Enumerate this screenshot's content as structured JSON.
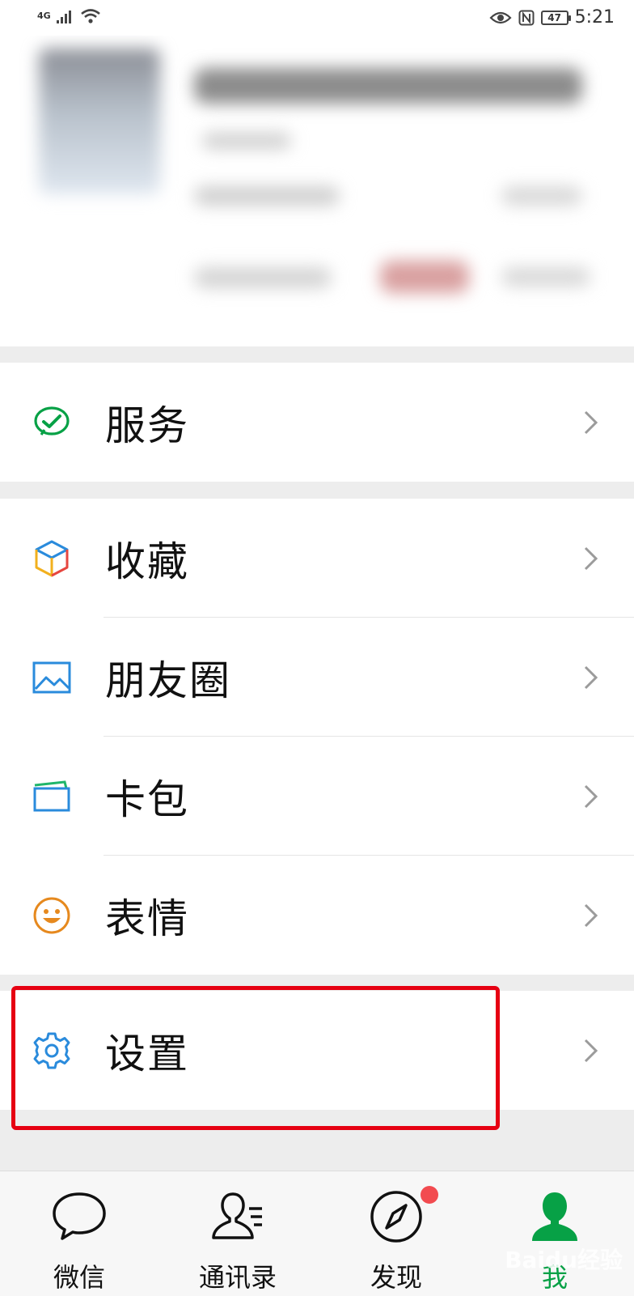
{
  "status_bar": {
    "network": "4G",
    "battery": "47",
    "time": "5:21"
  },
  "menu": {
    "service": {
      "label": "服务",
      "icon": "wechat-pay-icon",
      "color": "#07a146"
    },
    "favorites": {
      "label": "收藏",
      "icon": "cube-icon"
    },
    "moments": {
      "label": "朋友圈",
      "icon": "picture-icon",
      "color": "#2a8bdc"
    },
    "cards": {
      "label": "卡包",
      "icon": "card-wallet-icon"
    },
    "stickers": {
      "label": "表情",
      "icon": "smiley-icon",
      "color": "#e6891e"
    },
    "settings": {
      "label": "设置",
      "icon": "gear-icon",
      "color": "#2a8bdc"
    }
  },
  "tabbar": {
    "chats": {
      "label": "微信",
      "icon": "chat-bubble-icon"
    },
    "contacts": {
      "label": "通讯录",
      "icon": "contacts-icon"
    },
    "discover": {
      "label": "发现",
      "icon": "compass-icon",
      "has_badge": true
    },
    "me": {
      "label": "我",
      "icon": "person-icon",
      "active": true,
      "color": "#07a146"
    }
  },
  "watermark": "Baidu经验"
}
